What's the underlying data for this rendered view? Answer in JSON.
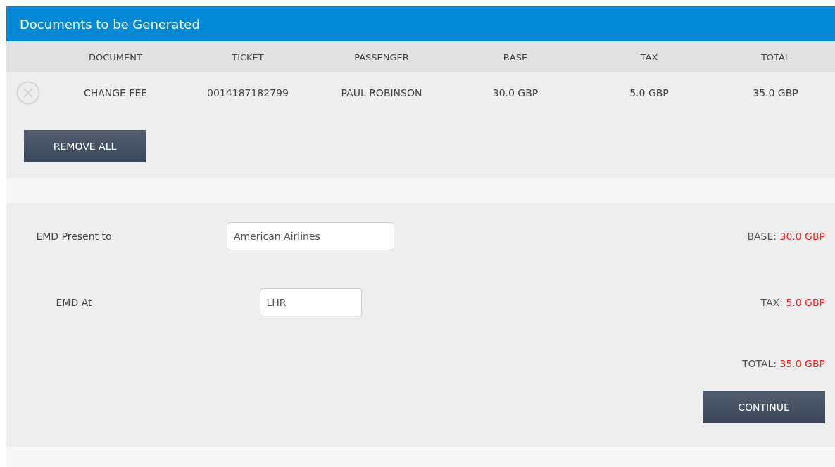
{
  "panel": {
    "title": "Documents to be Generated"
  },
  "table": {
    "columns": [
      "DOCUMENT",
      "TICKET",
      "PASSENGER",
      "BASE",
      "TAX",
      "TOTAL"
    ],
    "rows": [
      {
        "cells": [
          "CHANGE FEE",
          "0014187182799",
          "PAUL ROBINSON",
          "30.0 GBP",
          "5.0 GBP",
          "35.0 GBP"
        ]
      }
    ]
  },
  "remove_all_button": "REMOVE ALL",
  "form": {
    "fields": [
      {
        "label": "EMD Present to",
        "value": "American Airlines",
        "kind": "wide"
      },
      {
        "label": "EMD At",
        "value": "LHR",
        "kind": "narrow"
      }
    ]
  },
  "totals": [
    {
      "label": "BASE:",
      "value": "30.0 GBP"
    },
    {
      "label": "TAX:",
      "value": "5.0 GBP"
    },
    {
      "label": "TOTAL:",
      "value": "35.0 GBP"
    }
  ],
  "continue_button": "CONTINUE"
}
